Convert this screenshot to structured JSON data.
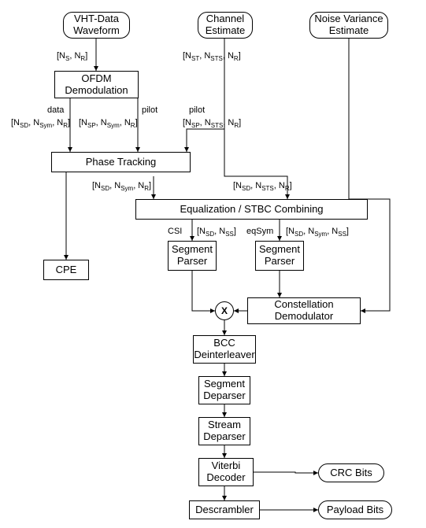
{
  "inputs": {
    "vht": "VHT-Data\nWaveform",
    "channel": "Channel\nEstimate",
    "noise": "Noise Variance\nEstimate"
  },
  "blocks": {
    "ofdm": "OFDM\nDemodulation",
    "phase": "Phase Tracking",
    "cpe": "CPE",
    "equal": "Equalization / STBC Combining",
    "seg_csi": "Segment\nParser",
    "seg_eq": "Segment\nParser",
    "const": "Constellation\nDemodulator",
    "combine": "X",
    "bcc": "BCC\nDeinterleaver",
    "seg_deparse": "Segment\nDeparser",
    "stream_deparse": "Stream\nDeparser",
    "viterbi": "Viterbi\nDecoder",
    "descr": "Descrambler"
  },
  "outputs": {
    "crc": "CRC Bits",
    "payload": "Payload Bits"
  },
  "labels": {
    "ns_nr": "[N<sub>S</sub>, N<sub>R</sub>]",
    "nst_nsts_nr": "[N<sub>ST</sub>, N<sub>STS</sub>, N<sub>R</sub>]",
    "data": "data",
    "pilot": "pilot",
    "nsd_nsym_nr": "[N<sub>SD</sub>, N<sub>Sym</sub>, N<sub>R</sub>]",
    "nsp_nsym_nr": "[N<sub>SP</sub>, N<sub>Sym</sub>, N<sub>R</sub>]",
    "nsp_nsts_nr": "[N<sub>SP</sub>, N<sub>STS</sub>, N<sub>R</sub>]",
    "nsd_nsts_nr": "[N<sub>SD</sub>, N<sub>STS</sub>, N<sub>R</sub>]",
    "csi": "CSI",
    "nsd_nss": "[N<sub>SD</sub>, N<sub>SS</sub>]",
    "eqsym": "eqSym",
    "nsd_nsym_nss": "[N<sub>SD</sub>, N<sub>Sym</sub>, N<sub>SS</sub>]"
  }
}
